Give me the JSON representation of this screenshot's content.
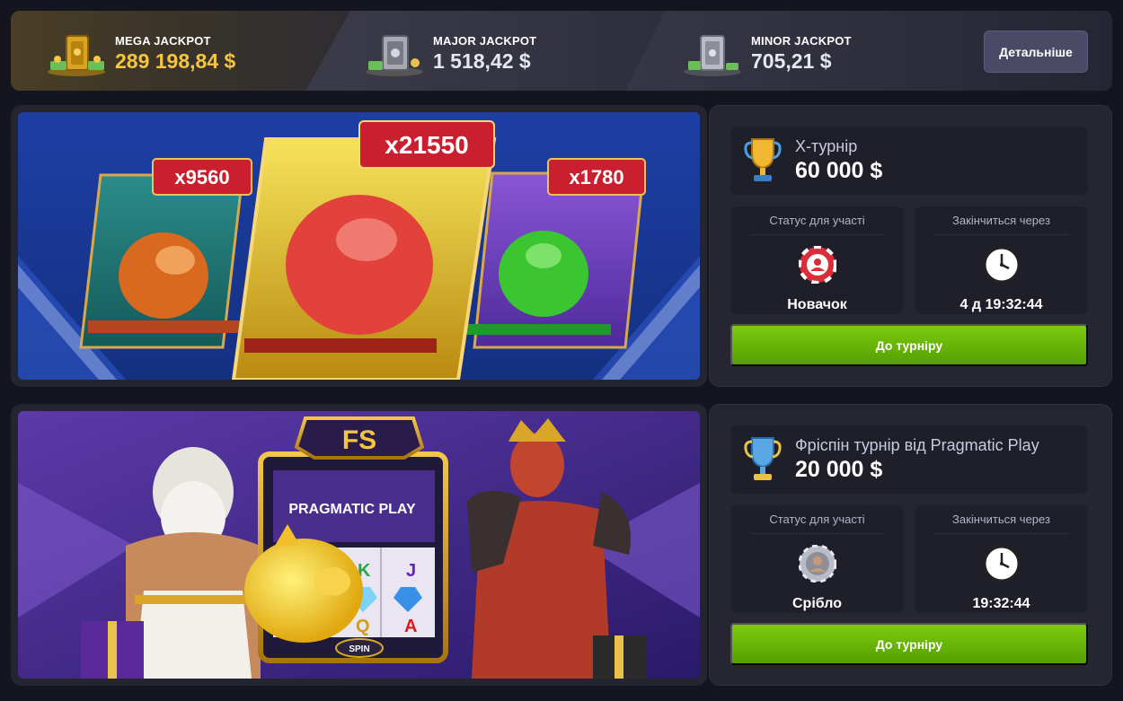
{
  "jackpots": {
    "mega": {
      "name": "MEGA JACKPOT",
      "amount": "289 198,84 $",
      "icon": "gold-safe-icon"
    },
    "major": {
      "name": "MAJOR JACKPOT",
      "amount": "1 518,42 $",
      "icon": "silver-safe-icon"
    },
    "minor": {
      "name": "MINOR JACKPOT",
      "amount": "705,21 $",
      "icon": "steel-safe-icon"
    },
    "details_label": "Детальніше"
  },
  "tournaments": [
    {
      "title": "X-турнір",
      "prize": "60 000 $",
      "trophy_color": "#f2b632",
      "status_label": "Статус для участі",
      "status_value": "Новачок",
      "status_icon": "red-chip-icon",
      "ends_label": "Закінчиться через",
      "ends_value": "4 д 19:32:44",
      "ends_icon": "clock-icon",
      "cta_label": "До турніру",
      "banner": {
        "multipliers": [
          "x9560",
          "x21550",
          "x1780"
        ]
      }
    },
    {
      "title": "Фріспін турнір від Pragmatic Play",
      "prize": "20 000 $",
      "trophy_color": "#5aa7e6",
      "status_label": "Статус для участі",
      "status_value": "Срібло",
      "status_icon": "silver-chip-icon",
      "ends_label": "Закінчиться через",
      "ends_value": "19:32:44",
      "ends_icon": "clock-icon",
      "cta_label": "До турніру",
      "banner": {
        "badge": "FS",
        "brand": "PRAGMATIC PLAY",
        "reel_symbols": [
          "K",
          "J",
          "Q",
          "A"
        ],
        "spin_label": "SPIN"
      }
    }
  ]
}
